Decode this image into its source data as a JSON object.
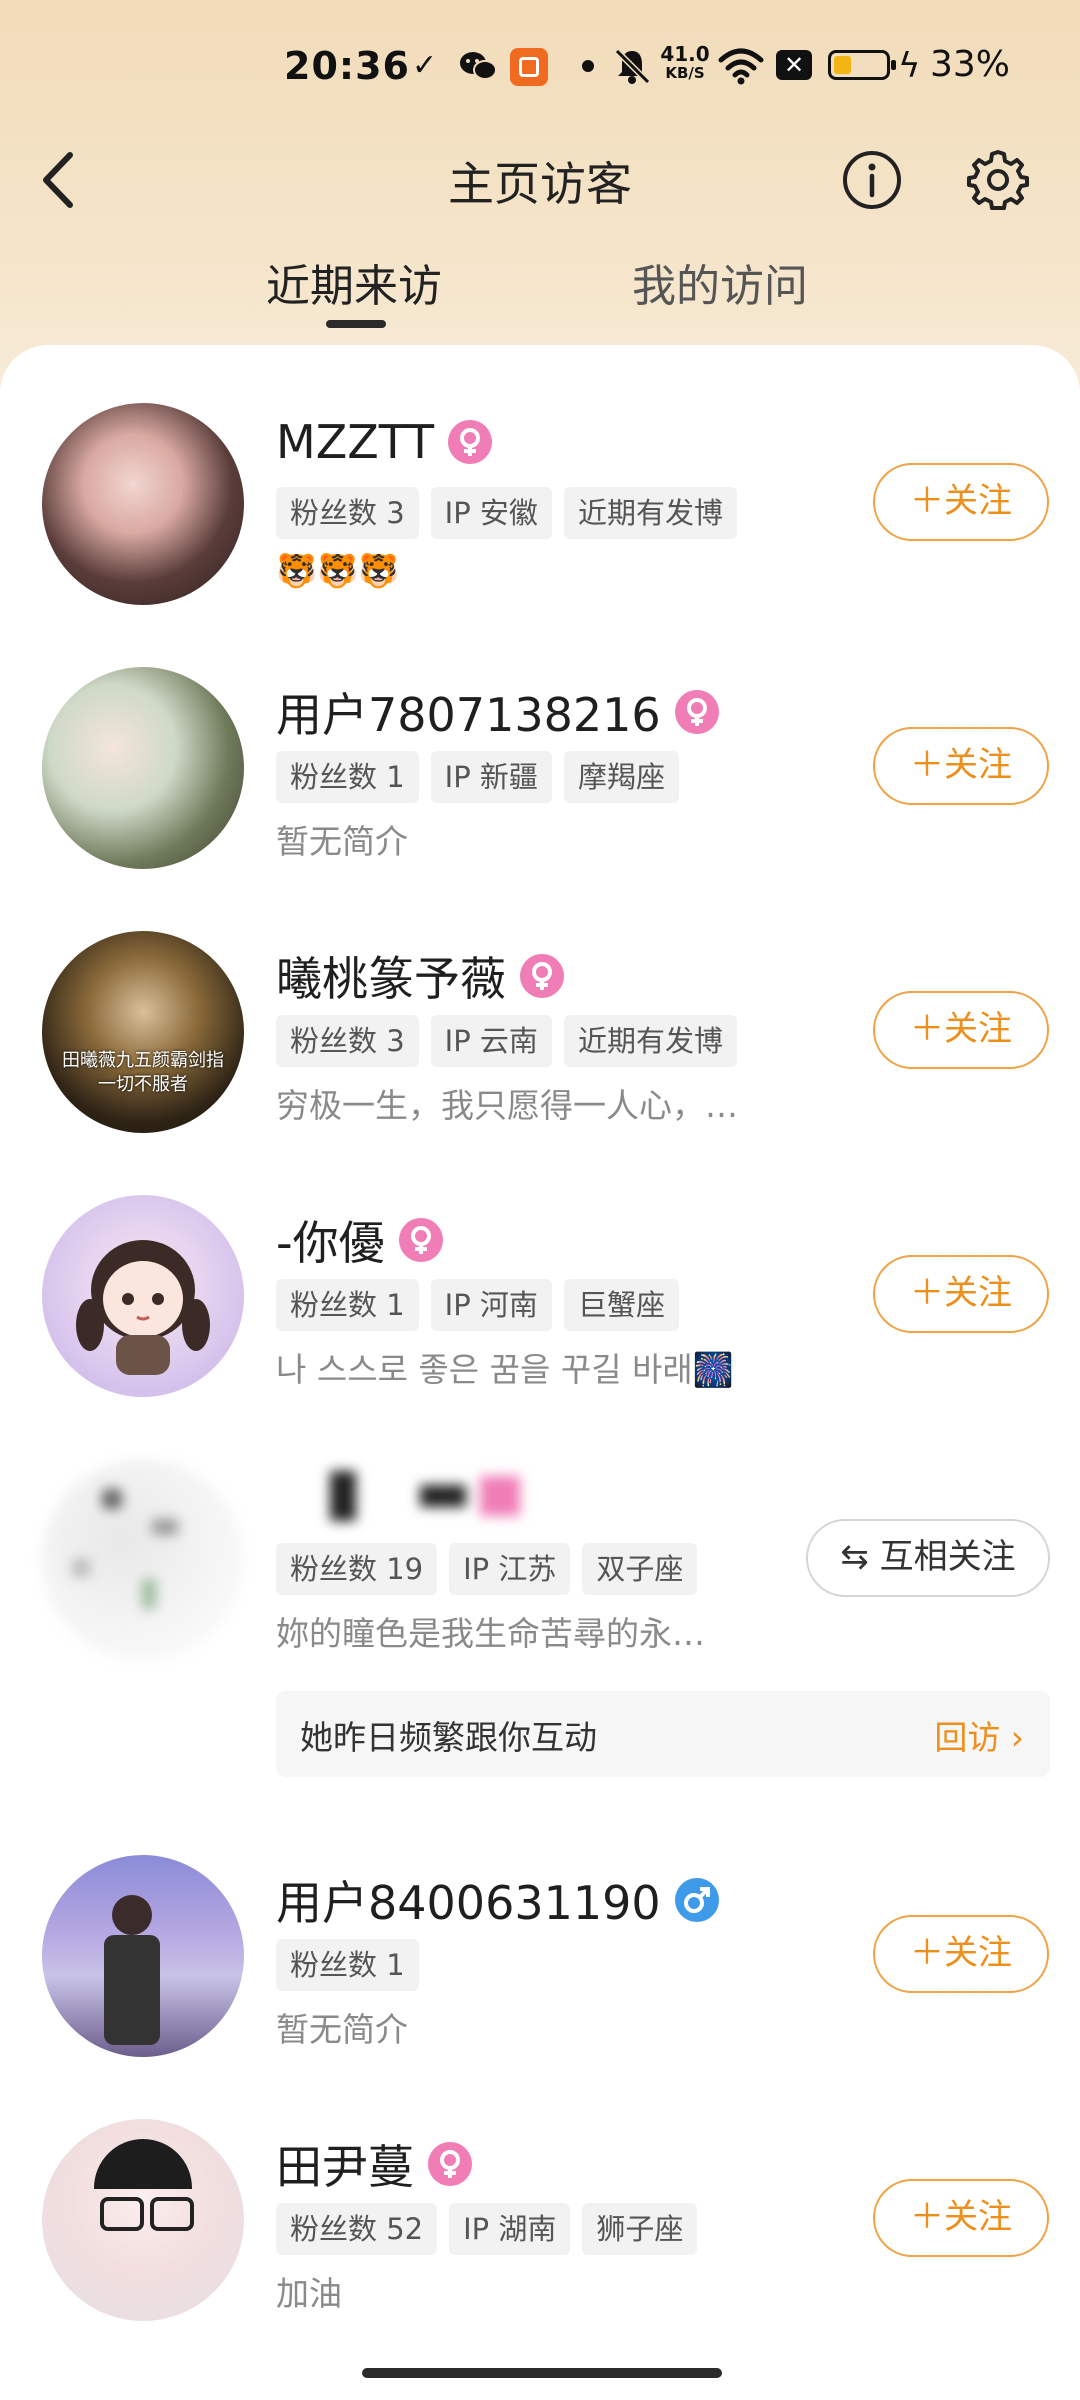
{
  "status_bar": {
    "time": "20:36",
    "net_speed_value": "41.0",
    "net_speed_unit": "KB/S",
    "battery_percent": "33%",
    "battery_level": 0.33
  },
  "header": {
    "title": "主页访客",
    "back_icon": "chevron-left-icon",
    "info_icon": "info-icon",
    "settings_icon": "gear-icon"
  },
  "tabs": [
    {
      "label": "近期来访",
      "active": true
    },
    {
      "label": "我的访问",
      "active": false
    }
  ],
  "colors": {
    "accent": "#ed8f1d",
    "female": "#f07db6",
    "male": "#3f9bea"
  },
  "visitors": [
    {
      "name": "MZZTT",
      "gender": "female",
      "tags": [
        "粉丝数 3",
        "IP 安徽",
        "近期有发博"
      ],
      "bio": "🐯🐯🐯",
      "action": "＋关注"
    },
    {
      "name": "用户7807138216",
      "gender": "female",
      "tags": [
        "粉丝数 1",
        "IP 新疆",
        "摩羯座"
      ],
      "bio": "暂无简介",
      "action": "＋关注"
    },
    {
      "name": "曦桃篆予薇",
      "gender": "female",
      "tags": [
        "粉丝数 3",
        "IP 云南",
        "近期有发博"
      ],
      "bio": "穷极一生，我只愿得一人心，…",
      "action": "＋关注",
      "avatar_caption": [
        "田曦薇九五颜霸剑指",
        "一切不服者"
      ]
    },
    {
      "name": "-你優",
      "gender": "female",
      "tags": [
        "粉丝数 1",
        "IP 河南",
        "巨蟹座"
      ],
      "bio": "나 스스로 좋은 꿈을 꾸길 바래🎆",
      "action": "＋关注"
    },
    {
      "name": "",
      "gender": "female",
      "tags": [
        "粉丝数 19",
        "IP 江苏",
        "双子座"
      ],
      "bio": "妳的瞳色是我生命苦尋的永…",
      "action": "⇆ 互相关注",
      "interaction_note": "她昨日频繁跟你互动",
      "revisit_label": "回访 ›"
    },
    {
      "name": "用户8400631190",
      "gender": "male",
      "tags": [
        "粉丝数 1"
      ],
      "bio": "暂无简介",
      "action": "＋关注"
    },
    {
      "name": "田尹蔓",
      "gender": "female",
      "tags": [
        "粉丝数 52",
        "IP 湖南",
        "狮子座"
      ],
      "bio": "加油",
      "action": "＋关注"
    }
  ]
}
